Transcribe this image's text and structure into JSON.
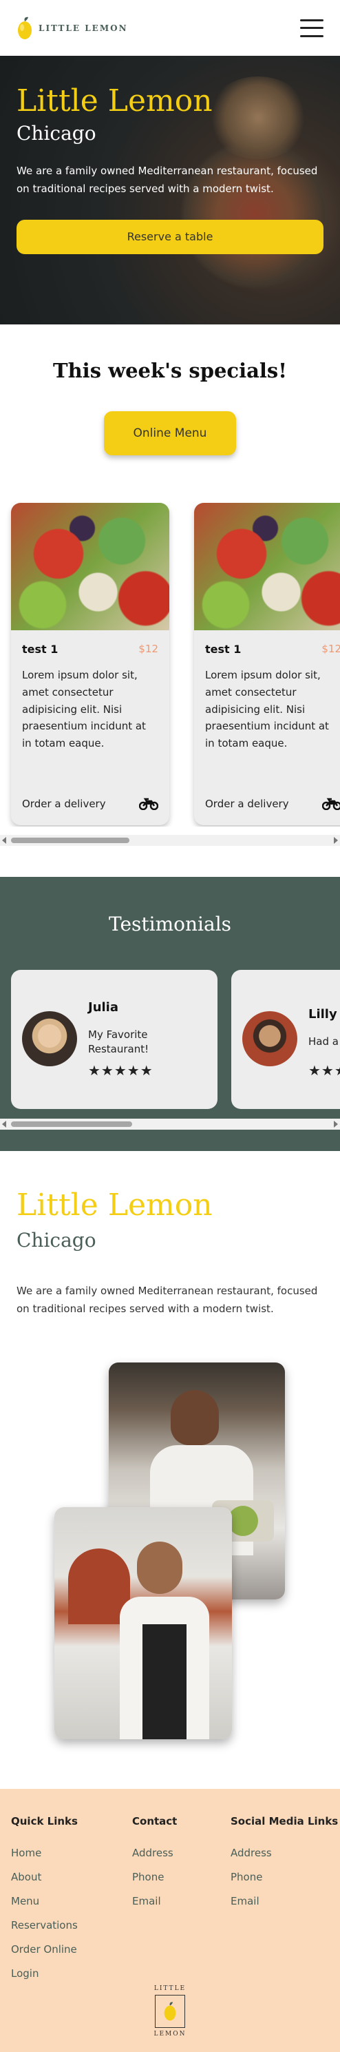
{
  "header": {
    "brand": "LITTLE LEMON"
  },
  "hero": {
    "title": "Little Lemon",
    "subtitle": "Chicago",
    "description": "We are a family owned Mediterranean restaurant, focused on traditional recipes served with a modern twist.",
    "cta": "Reserve a table"
  },
  "specials": {
    "heading": "This week's specials!",
    "menu_button": "Online Menu",
    "cards": [
      {
        "title": "test 1",
        "price": "$12",
        "description": "Lorem ipsum dolor sit, amet consectetur adipisicing elit. Nisi praesentium incidunt at in totam eaque.",
        "delivery": "Order a delivery"
      },
      {
        "title": "test 1",
        "price": "$12",
        "description": "Lorem ipsum dolor sit, amet consectetur adipisicing elit. Nisi praesentium incidunt at in totam eaque.",
        "delivery": "Order a delivery"
      }
    ]
  },
  "testimonials": {
    "heading": "Testimonials",
    "items": [
      {
        "name": "Julia",
        "quote": "My Favorite Restaurant!",
        "stars": "★★★★★"
      },
      {
        "name": "Lilly",
        "quote": "Had a",
        "stars": "★★★"
      }
    ]
  },
  "about": {
    "title": "Little Lemon",
    "subtitle": "Chicago",
    "description": "We are a family owned Mediterranean restaurant, focused on traditional recipes served with a modern twist."
  },
  "footer": {
    "quick_links": {
      "heading": "Quick Links",
      "items": [
        "Home",
        "About",
        "Menu",
        "Reservations",
        "Order Online",
        "Login"
      ]
    },
    "contact": {
      "heading": "Contact",
      "items": [
        "Address",
        "Phone",
        "Email"
      ]
    },
    "social": {
      "heading": "Social Media Links",
      "items": [
        "Address",
        "Phone",
        "Email"
      ]
    },
    "logo_top": "LITTLE",
    "logo_bottom": "LEMON"
  },
  "colors": {
    "primary_green": "#495e57",
    "primary_yellow": "#f4ce14",
    "price_orange": "#ee9972",
    "footer_peach": "#fbdabb"
  },
  "icons": {
    "brand": "lemon-logo-icon",
    "menu": "hamburger-menu-icon",
    "delivery": "motorbike-icon",
    "rating": "star-icon"
  }
}
